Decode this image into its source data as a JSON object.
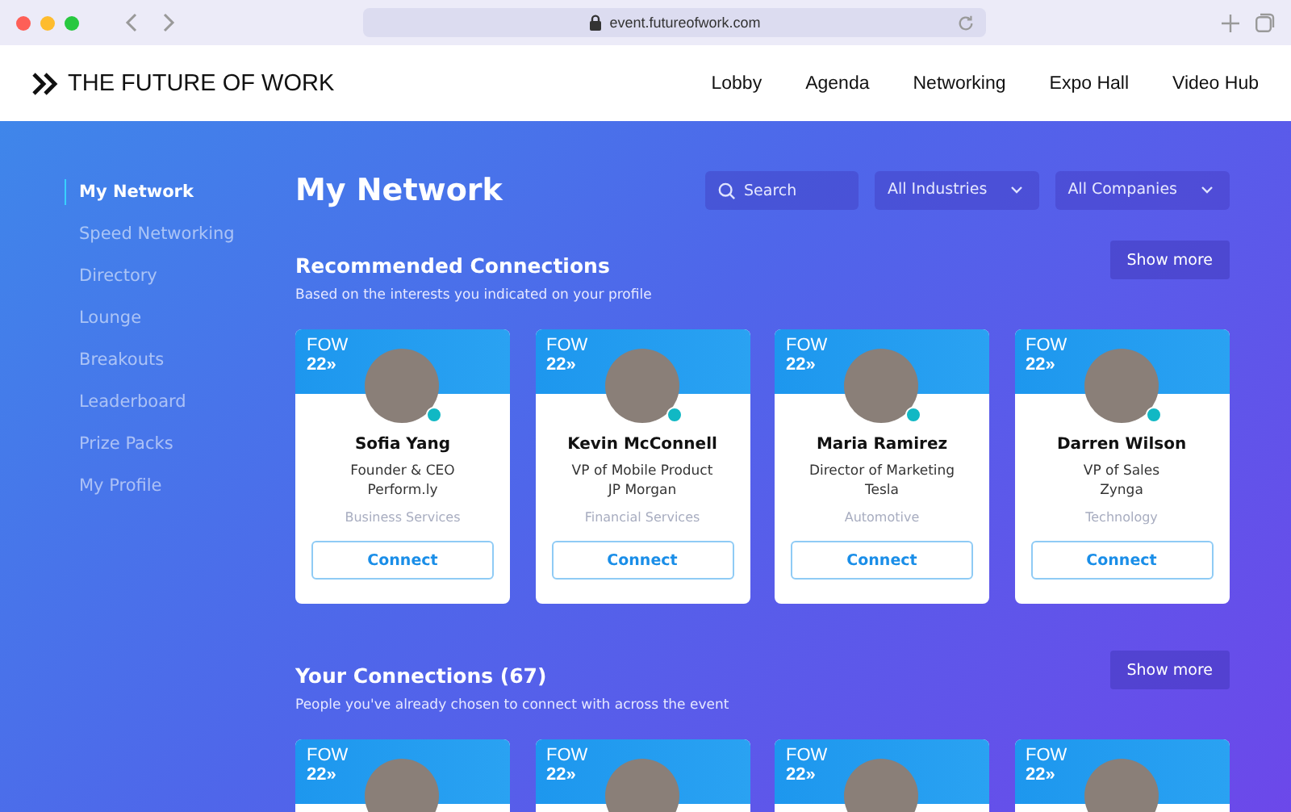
{
  "browser": {
    "url": "event.futureofwork.com"
  },
  "header": {
    "logo_text": "THE FUTURE OF WORK",
    "nav": [
      "Lobby",
      "Agenda",
      "Networking",
      "Expo Hall",
      "Video Hub"
    ]
  },
  "sidebar": {
    "items": [
      {
        "label": "My Network",
        "selected": true
      },
      {
        "label": "Speed Networking",
        "selected": false
      },
      {
        "label": "Directory",
        "selected": false
      },
      {
        "label": "Lounge",
        "selected": false
      },
      {
        "label": "Breakouts",
        "selected": false
      },
      {
        "label": "Leaderboard",
        "selected": false
      },
      {
        "label": "Prize Packs",
        "selected": false
      },
      {
        "label": "My Profile",
        "selected": false
      }
    ]
  },
  "page": {
    "title": "My Network",
    "search": {
      "placeholder": "Search"
    },
    "filters": [
      "All Industries",
      "All Companies"
    ]
  },
  "sections": [
    {
      "title": "Recommended Connections",
      "subtitle": "Based on the interests you indicated on your profile",
      "show_more": "Show more",
      "cards": [
        {
          "badge_top": "FOW",
          "badge_bottom": "22»",
          "name": "Sofia Yang",
          "role": "Founder & CEO",
          "company": "Perform.ly",
          "industry": "Business Services",
          "button": "Connect",
          "online": true
        },
        {
          "badge_top": "FOW",
          "badge_bottom": "22»",
          "name": "Kevin McConnell",
          "role": "VP of Mobile Product",
          "company": "JP Morgan",
          "industry": "Financial Services",
          "button": "Connect",
          "online": true
        },
        {
          "badge_top": "FOW",
          "badge_bottom": "22»",
          "name": "Maria Ramirez",
          "role": "Director of Marketing",
          "company": "Tesla",
          "industry": "Automotive",
          "button": "Connect",
          "online": true
        },
        {
          "badge_top": "FOW",
          "badge_bottom": "22»",
          "name": "Darren Wilson",
          "role": "VP of Sales",
          "company": "Zynga",
          "industry": "Technology",
          "button": "Connect",
          "online": true
        }
      ]
    },
    {
      "title": "Your Connections (67)",
      "subtitle": "People you've already chosen to connect with across the event",
      "show_more": "Show more",
      "cards": [
        {
          "badge_top": "FOW",
          "badge_bottom": "22»"
        },
        {
          "badge_top": "FOW",
          "badge_bottom": "22»"
        },
        {
          "badge_top": "FOW",
          "badge_bottom": "22»"
        },
        {
          "badge_top": "FOW",
          "badge_bottom": "22»"
        }
      ]
    }
  ]
}
